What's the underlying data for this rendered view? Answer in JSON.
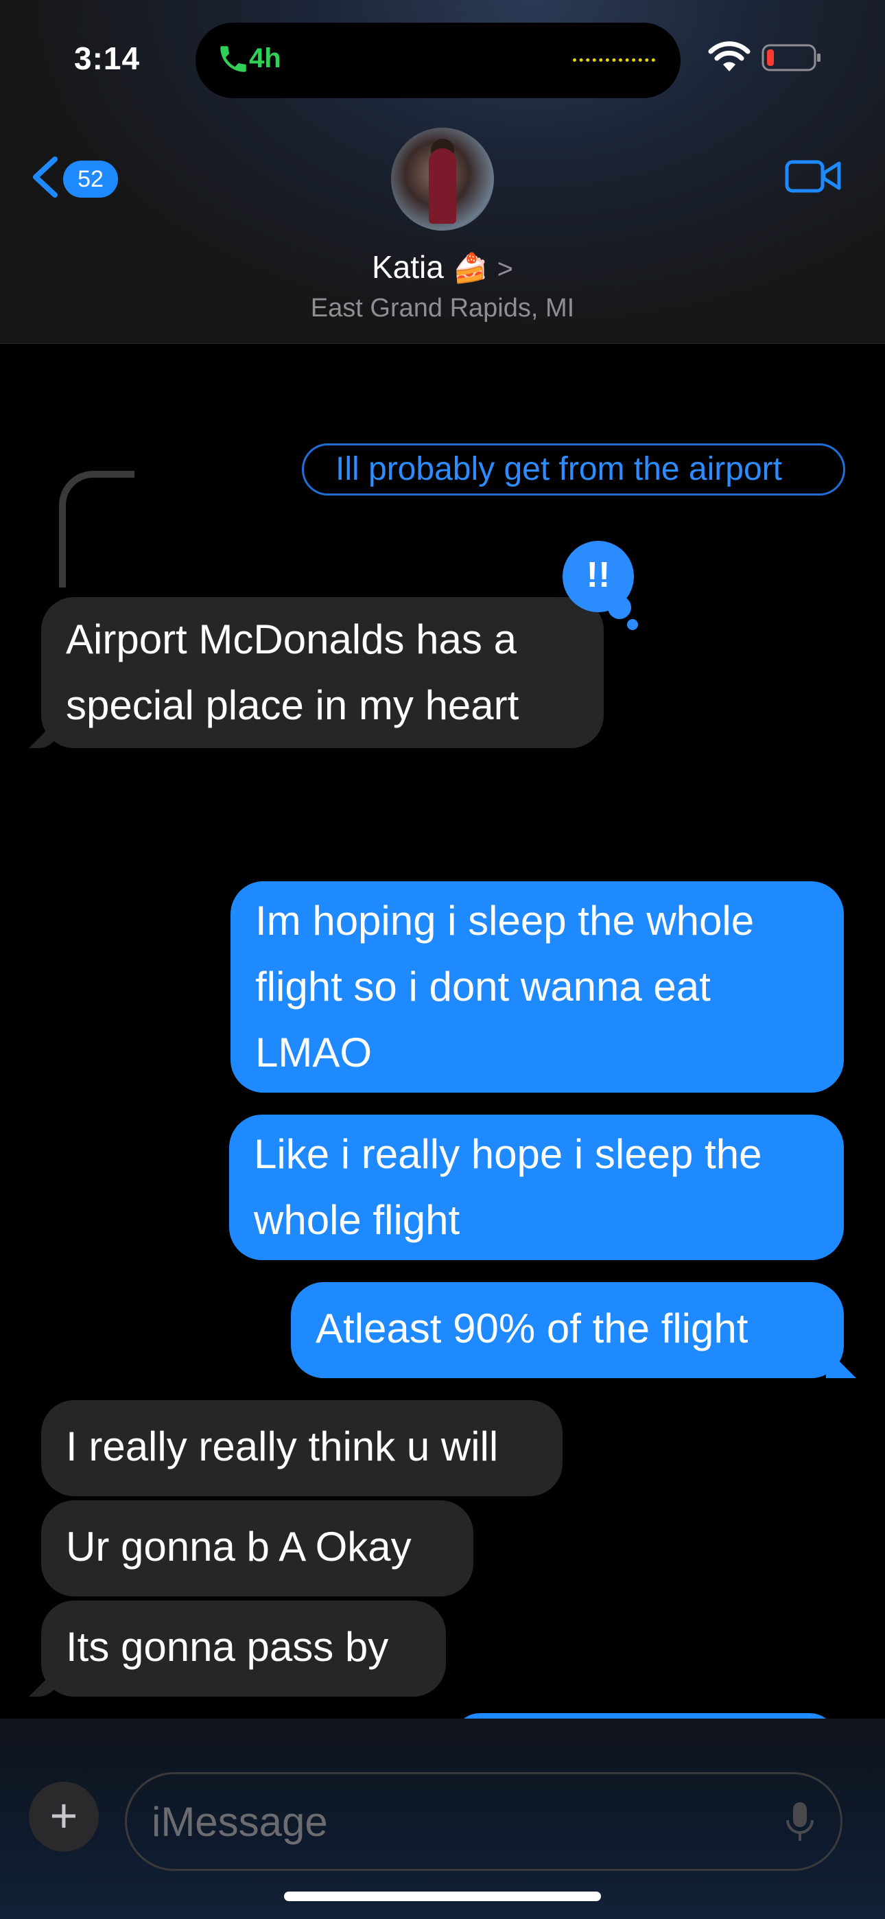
{
  "status_bar": {
    "time": "3:14",
    "call_duration": "4h"
  },
  "header": {
    "back_badge_count": "52",
    "contact_name": "Katia",
    "contact_emoji": "🍰",
    "chevron": ">",
    "contact_location": "East Grand Rapids, MI"
  },
  "messages": {
    "reply_quote": "Ill probably get from the airport",
    "tapback": "!!",
    "items": [
      {
        "side": "received",
        "text_lines": [
          "Airport McDonalds has a",
          "special place in my heart"
        ]
      },
      {
        "side": "sent",
        "text_lines": [
          "Im hoping i sleep the whole",
          "flight so i dont wanna eat",
          "LMAO"
        ]
      },
      {
        "side": "sent",
        "text_lines": [
          "Like i really hope i sleep the",
          "whole flight"
        ]
      },
      {
        "side": "sent",
        "text_lines": [
          "Atleast 90% of the flight"
        ]
      },
      {
        "side": "received",
        "text_lines": [
          "I really really think u will"
        ]
      },
      {
        "side": "received",
        "text_lines": [
          "Ur gonna b A Okay"
        ]
      },
      {
        "side": "received",
        "text_lines": [
          "Its gonna pass by"
        ]
      }
    ]
  },
  "composer": {
    "placeholder": "iMessage",
    "plus_label": "+"
  },
  "colors": {
    "accent": "#1f8aff",
    "received_bubble": "#262628",
    "call_green": "#31d158",
    "battery_low": "#ff3b30"
  }
}
